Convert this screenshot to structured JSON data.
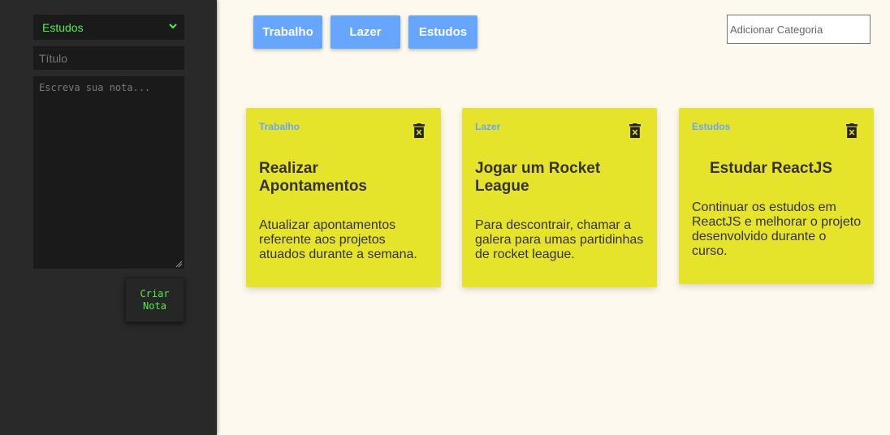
{
  "sidebar": {
    "category_select": {
      "selected": "Estudos"
    },
    "title_input": {
      "placeholder": "Título"
    },
    "note_textarea": {
      "placeholder": "Escreva sua nota..."
    },
    "create_button": {
      "label": "Criar\nNota"
    }
  },
  "categories": [
    "Trabalho",
    "Lazer",
    "Estudos"
  ],
  "add_category": {
    "placeholder": "Adicionar Categoria"
  },
  "notes": [
    {
      "category": "Trabalho",
      "title": "Realizar Apontamentos",
      "text": "Atualizar apontamentos referente aos projetos atuados durante a semana."
    },
    {
      "category": "Lazer",
      "title": "Jogar um Rocket League",
      "text": "Para descontrair, chamar a galera para umas partidinhas de rocket league."
    },
    {
      "category": "Estudos",
      "title": "Estudar ReactJS",
      "text": "Continuar os estudos em ReactJS e melhorar o projeto desenvolvido durante o curso."
    }
  ],
  "colors": {
    "accent_green": "#4ff04a",
    "category_blue": "#66a6ff",
    "card_yellow": "#e6e42a"
  }
}
